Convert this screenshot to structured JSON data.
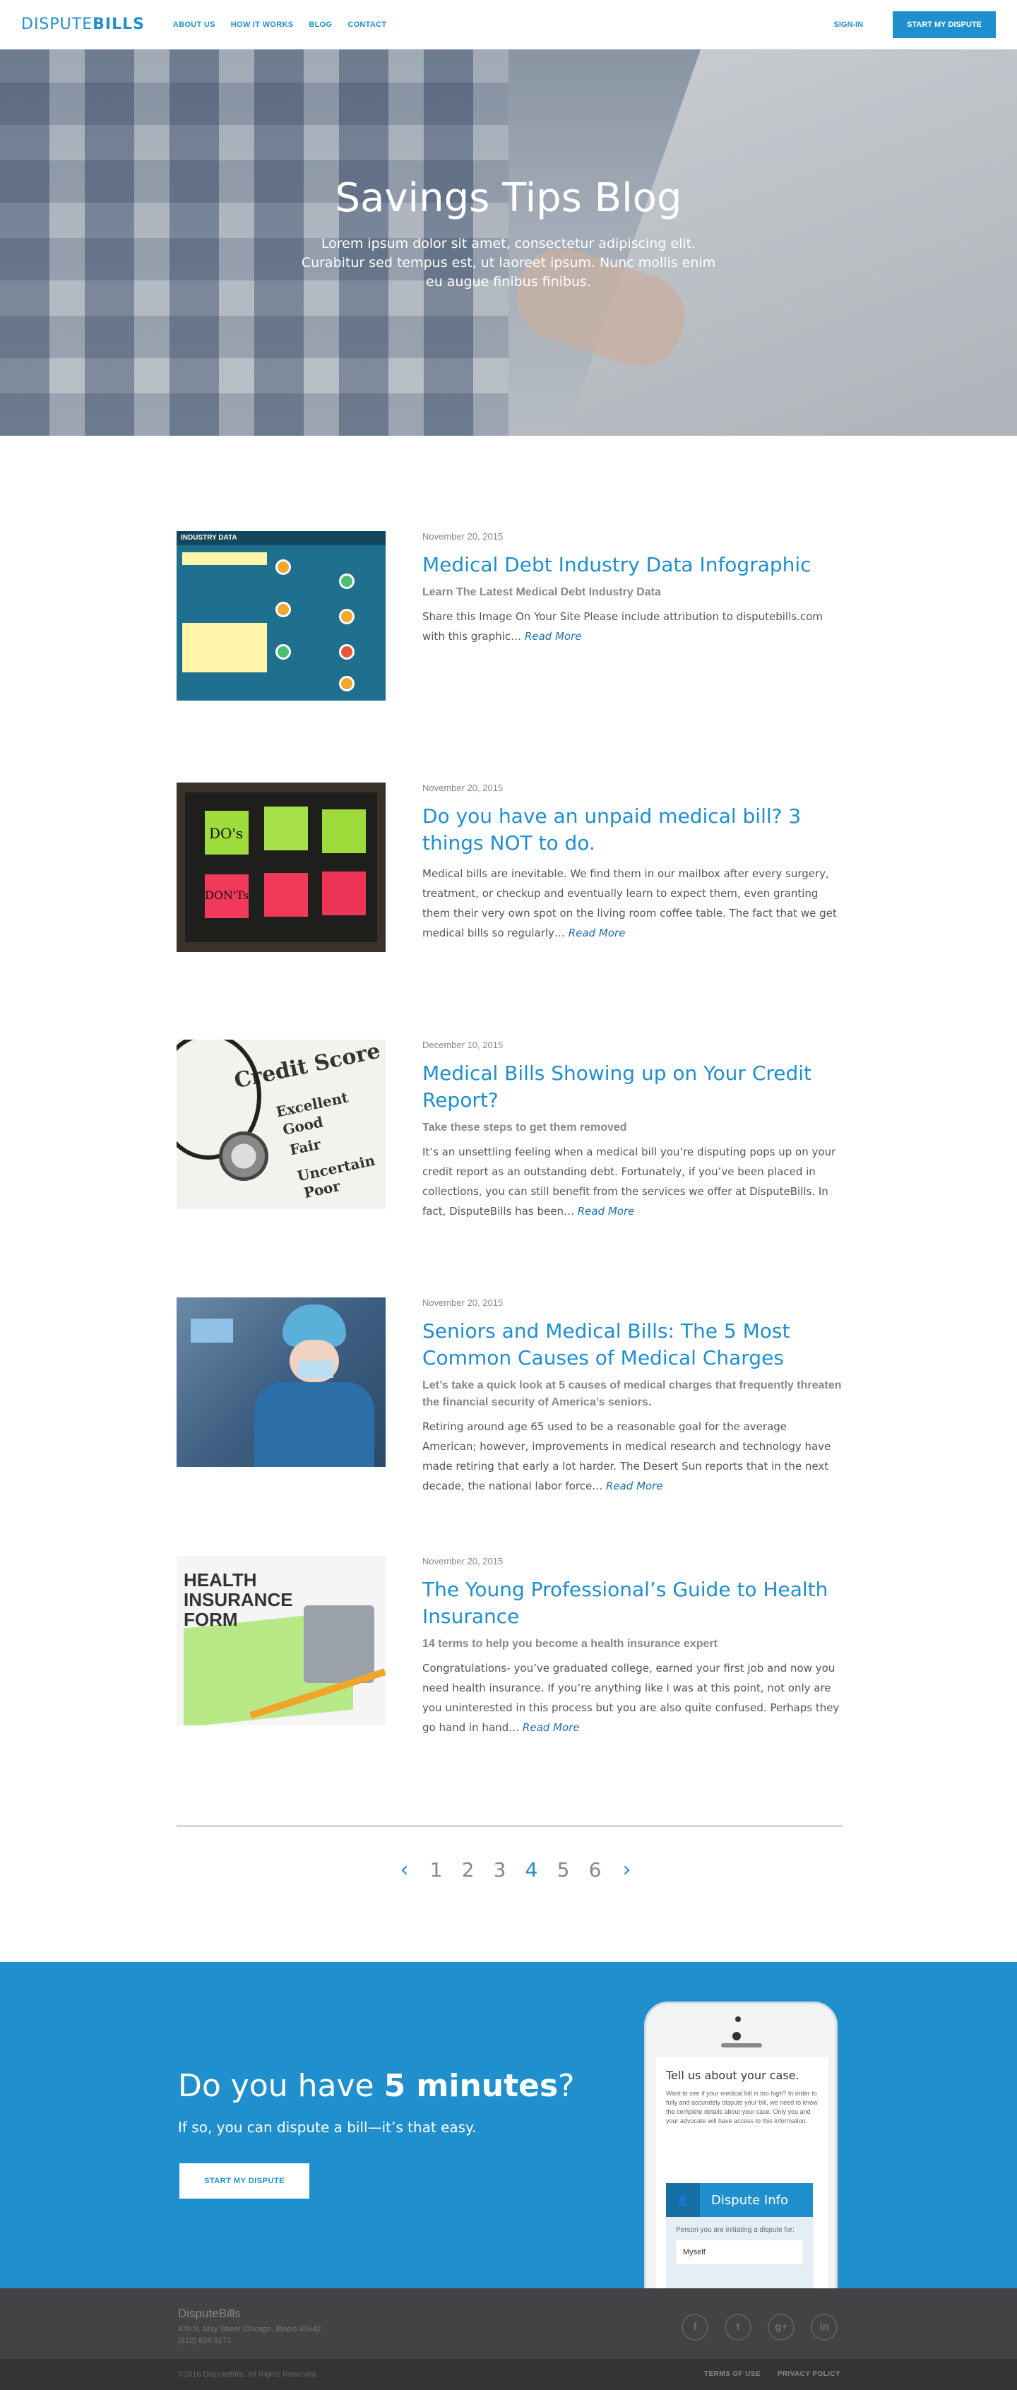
{
  "header": {
    "logo_light": "DISPUTE",
    "logo_bold": "BILLS",
    "nav": [
      "ABOUT US",
      "HOW IT WORKS",
      "BLOG",
      "CONTACT"
    ],
    "signin": "SIGN-IN",
    "cta": "START MY DISPUTE"
  },
  "hero": {
    "title": "Savings Tips Blog",
    "subtitle": "Lorem ipsum dolor sit amet, consectetur adipiscing elit. Curabitur sed tempus est, ut laoreet ipsum. Nunc mollis enim eu augue finibus finibus."
  },
  "posts": [
    {
      "date": "November 20, 2015",
      "title": "Medical Debt Industry Data Infographic",
      "subtitle": "Learn The Latest Medical Debt Industry Data",
      "excerpt": "Share this Image On Your Site Please include attribution to disputebills.com with this graphic…",
      "read_more": "Read More",
      "thumb_label": "INDUSTRY DATA"
    },
    {
      "date": "November 20, 2015",
      "title": "Do you have an unpaid medical bill? 3 things NOT to do.",
      "subtitle": "",
      "excerpt": "Medical bills are inevitable. We find them in our mailbox after every surgery, treatment, or checkup and eventually learn to expect them, even granting them their very own spot on the living room coffee table. The fact that we get medical bills so regularly…",
      "read_more": "Read More",
      "thumb_dos": "DO's",
      "thumb_donts": "DON'Ts"
    },
    {
      "date": "December 10, 2015",
      "title": "Medical Bills Showing up on Your Credit Report?",
      "subtitle": "Take these steps to get them removed",
      "excerpt": "It’s an unsettling feeling when a medical bill you’re disputing pops up on your credit report as an outstanding debt. Fortunately, if you’ve been placed in collections, you can still benefit from the services we offer at DisputeBills. In fact, DisputeBills has been…",
      "read_more": "Read More",
      "thumb_words": [
        "Credit Score",
        "Excellent",
        "Good",
        "Fair",
        "Uncertain",
        "Poor"
      ]
    },
    {
      "date": "November 20, 2015",
      "title": "Seniors and Medical Bills: The 5 Most Common Causes of Medical Charges",
      "subtitle": "Let’s take a quick look at 5 causes of medical charges that frequently threaten the financial security of America’s seniors.",
      "excerpt": "Retiring around age 65 used to be a reasonable goal for the average American; however, improvements in medical research and technology have made retiring that early a lot harder. The Desert Sun reports that in the next decade, the national labor force…",
      "read_more": "Read More"
    },
    {
      "date": "November 20, 2015",
      "title": "The Young Professional’s Guide to Health Insurance",
      "subtitle": "14 terms to help you become a health insurance expert",
      "excerpt": "Congratulations- you’ve graduated college, earned your first job and now you need health insurance.  If you’re anything like I was at this point, not only are you uninterested in this process but you are also quite confused.  Perhaps they go hand in hand…",
      "read_more": "Read More",
      "thumb_label": "HEALTH INSURANCE FORM"
    }
  ],
  "pagination": {
    "prev": "‹",
    "pages": [
      "1",
      "2",
      "3",
      "4",
      "5",
      "6"
    ],
    "current": "4",
    "next": "›"
  },
  "cta": {
    "heading_pre": "Do you have ",
    "heading_bold": "5 minutes",
    "heading_post": "?",
    "sub": "If so, you can dispute a bill—it’s that easy.",
    "button": "START MY DISPUTE",
    "phone": {
      "question": "Tell us about your case.",
      "desc": "Want to see if your medical bill is too high? In order to fully and accurately dispute your bill, we need to know the complete details about your case. Only you and your advocate will have access to this information.",
      "section_title": "Dispute Info",
      "field_label": "Person you are initiating a dispute for:",
      "field_value": "Myself"
    }
  },
  "footer": {
    "brand": "DisputeBills",
    "address": "470 N. May Street Chicago, Illinois 60642",
    "phone": "(312) 624-9171",
    "social": [
      "f",
      "t",
      "g+",
      "in"
    ],
    "copyright": "©2016 DisputeBills. All Rights Reserved.",
    "links": [
      "TERMS OF USE",
      "PRIVACY POLICY"
    ]
  },
  "colors": {
    "brand_blue": "#1f8fce",
    "footer_dark": "#434345"
  }
}
